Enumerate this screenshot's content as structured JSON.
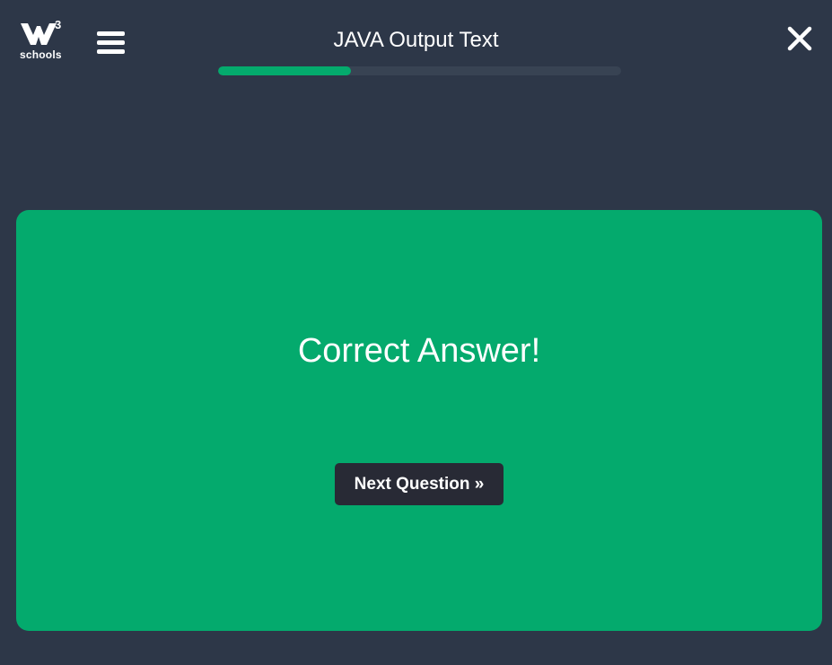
{
  "header": {
    "logo": {
      "superscript": "3",
      "wordmark": "schools",
      "icon": "w3schools-logo-icon"
    },
    "menu_icon": "hamburger-menu-icon",
    "title": "JAVA Output Text",
    "progress": 0.33,
    "close_icon": "close-icon"
  },
  "result": {
    "message": "Correct Answer!",
    "next_label": "Next Question »"
  },
  "colors": {
    "background": "#2d3748",
    "accent": "#04aa6d",
    "button": "#282a35",
    "progress_track": "#384353"
  }
}
